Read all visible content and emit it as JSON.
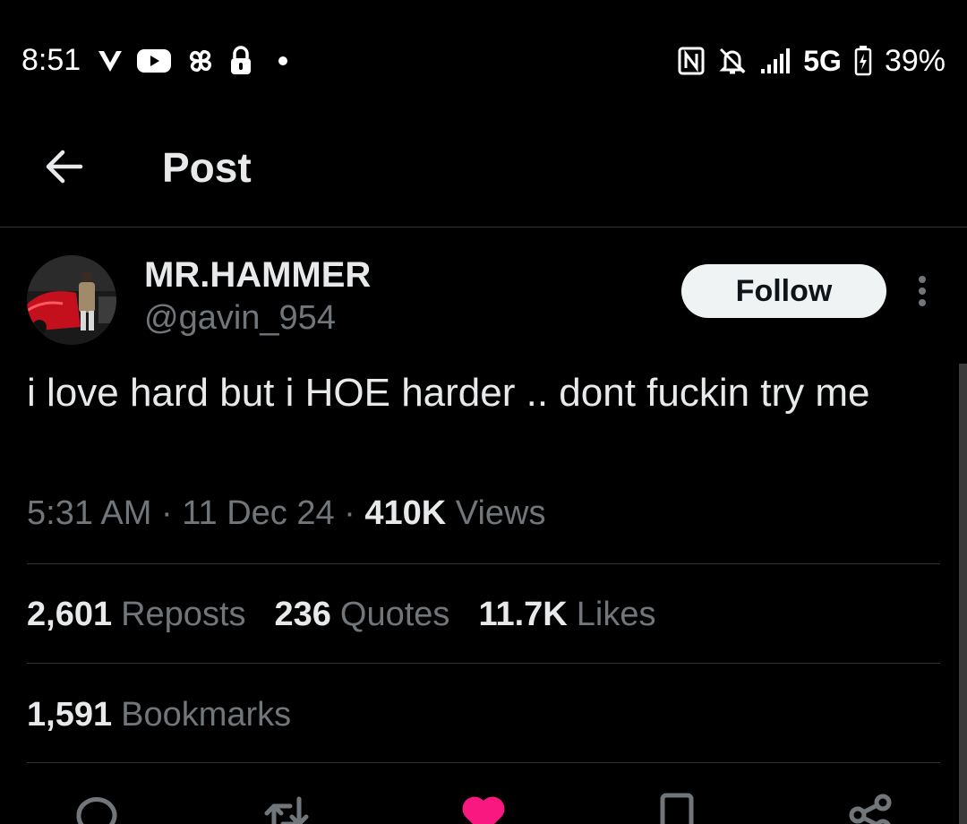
{
  "status_bar": {
    "time": "8:51",
    "network": "5G",
    "battery": "39%",
    "left_icons": [
      "verizon-v-icon",
      "youtube-icon",
      "pinwheel-icon",
      "lock-icon",
      "dot-icon"
    ],
    "right_icons": [
      "nfc-icon",
      "bell-muted-icon",
      "signal-icon",
      "battery-charging-icon"
    ]
  },
  "header": {
    "title": "Post"
  },
  "tweet": {
    "display_name": "MR.HAMMER",
    "handle": "@gavin_954",
    "follow_label": "Follow",
    "text": "i love hard but i HOE harder .. dont fuckin try me",
    "time": "5:31 AM",
    "separator": "·",
    "date": "11 Dec 24",
    "views_count": "410K",
    "views_label": "Views"
  },
  "stats": {
    "reposts_count": "2,601",
    "reposts_label": "Reposts",
    "quotes_count": "236",
    "quotes_label": "Quotes",
    "likes_count": "11.7K",
    "likes_label": "Likes",
    "bookmarks_count": "1,591",
    "bookmarks_label": "Bookmarks"
  },
  "actions": [
    "reply-icon",
    "repost-icon",
    "like-icon",
    "bookmark-icon",
    "share-icon"
  ],
  "colors": {
    "background": "#000000",
    "text_primary": "#e7e9ea",
    "text_secondary": "#71767b",
    "divider": "#2f3336",
    "like_active": "#f91880",
    "follow_bg": "#eff3f4"
  }
}
